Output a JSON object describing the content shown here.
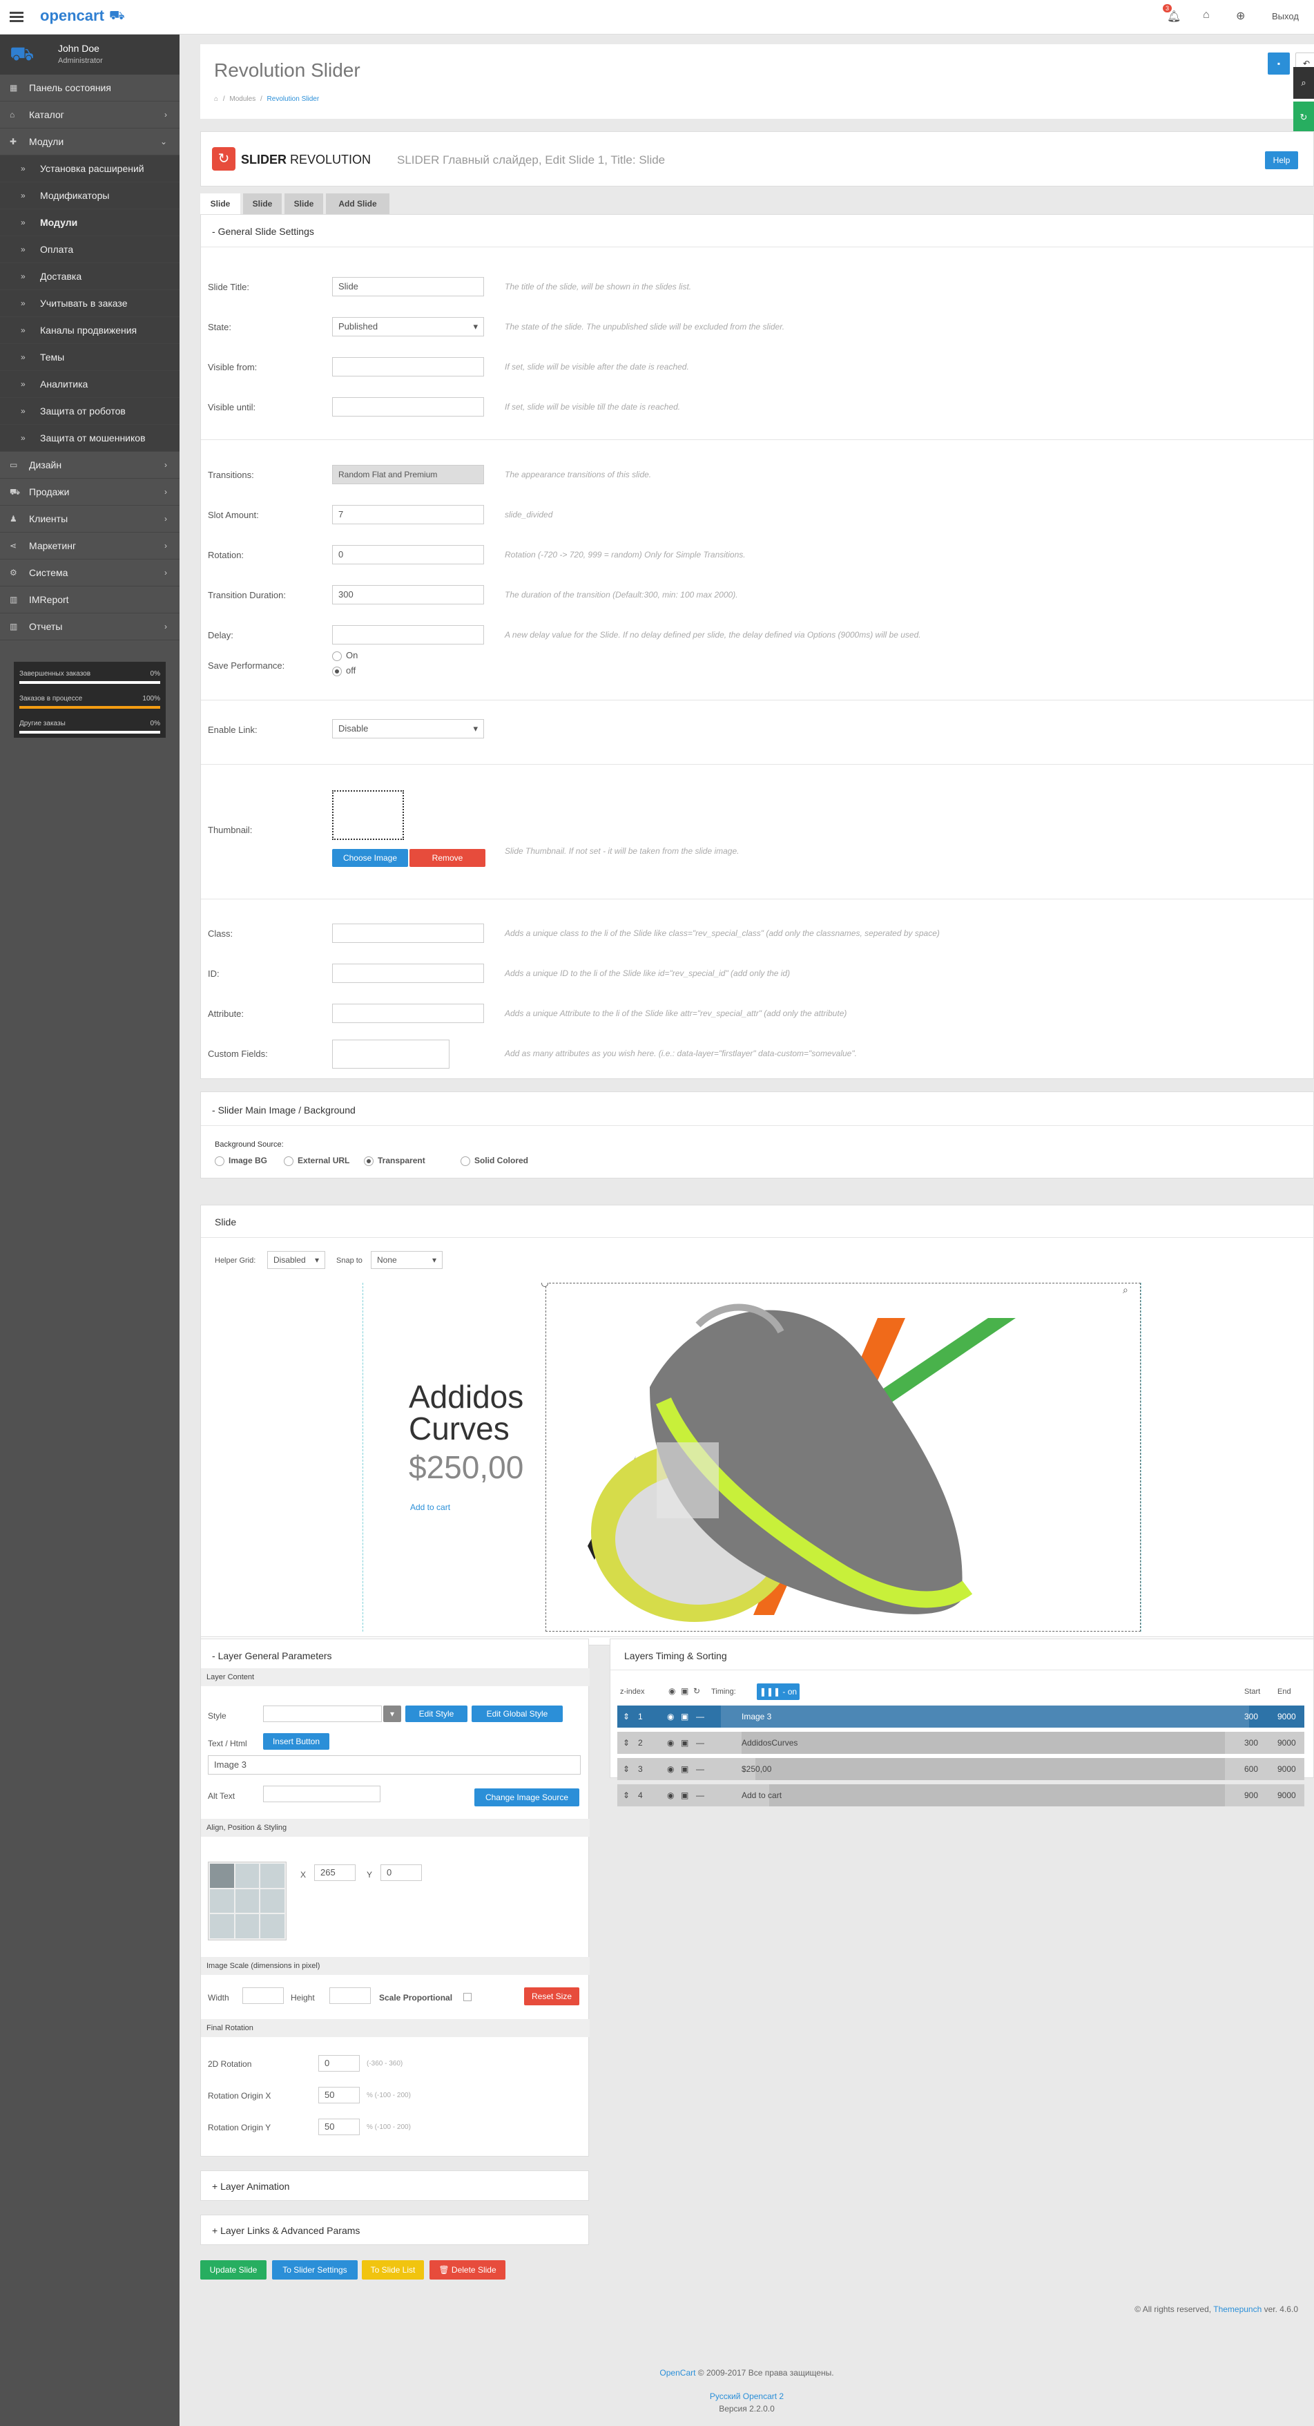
{
  "topbar": {
    "logo_text": "opencart",
    "notif_count": "3",
    "logout_label": "Выход"
  },
  "sidebar": {
    "user_name": "John Doe",
    "user_role": "Administrator",
    "items": [
      {
        "label": "Панель состояния",
        "icon": "dashboard-icon"
      },
      {
        "label": "Каталог",
        "icon": "tag-icon"
      },
      {
        "label": "Модули",
        "icon": "puzzle-icon"
      },
      {
        "label": "Установка расширений"
      },
      {
        "label": "Модификаторы"
      },
      {
        "label": "Модули"
      },
      {
        "label": "Оплата"
      },
      {
        "label": "Доставка"
      },
      {
        "label": "Учитывать в заказе"
      },
      {
        "label": "Каналы продвижения"
      },
      {
        "label": "Темы"
      },
      {
        "label": "Аналитика"
      },
      {
        "label": "Защита от роботов"
      },
      {
        "label": "Защита от мошенников"
      },
      {
        "label": "Дизайн",
        "icon": "monitor-icon"
      },
      {
        "label": "Продажи",
        "icon": "cart-icon"
      },
      {
        "label": "Клиенты",
        "icon": "user-icon"
      },
      {
        "label": "Маркетинг",
        "icon": "share-icon"
      },
      {
        "label": "Система",
        "icon": "cog-icon"
      },
      {
        "label": "IMReport",
        "icon": "chart-icon"
      },
      {
        "label": "Отчеты",
        "icon": "chart-icon"
      }
    ],
    "stats": [
      {
        "label": "Завершенных заказов",
        "value": "0%",
        "fill": 0
      },
      {
        "label": "Заказов в процессе",
        "value": "100%",
        "fill": 1
      },
      {
        "label": "Другие заказы",
        "value": "0%",
        "fill": 0
      }
    ]
  },
  "page": {
    "title": "Revolution Slider",
    "breadcrumb": [
      "Modules",
      "Revolution Slider"
    ]
  },
  "plugin": {
    "logo_bold": "SLIDER",
    "logo_light": "REVOLUTION",
    "subtitle": "SLIDER Главный слайдер, Edit Slide 1, Title: Slide",
    "help_label": "Help",
    "tabs": [
      "Slide",
      "Slide",
      "Slide",
      "Add Slide"
    ]
  },
  "general": {
    "heading": "General Slide Settings",
    "fields": [
      {
        "label": "Slide Title:",
        "value": "Slide",
        "hint": "The title of the slide, will be shown in the slides list."
      },
      {
        "label": "State:",
        "value": "Published",
        "hint": "The state of the slide. The unpublished slide will be excluded from the slider."
      },
      {
        "label": "Visible from:",
        "value": "",
        "hint": "If set, slide will be visible after the date is reached."
      },
      {
        "label": "Visible until:",
        "value": "",
        "hint": "If set, slide will be visible till the date is reached."
      },
      {
        "label": "Transitions:",
        "value": "Random Flat and Premium",
        "hint": "The appearance transitions of this slide."
      },
      {
        "label": "Slot Amount:",
        "value": "7",
        "hint": "slide_divided"
      },
      {
        "label": "Rotation:",
        "value": "0",
        "hint": "Rotation (-720 -> 720, 999 = random) Only for Simple Transitions."
      },
      {
        "label": "Transition Duration:",
        "value": "300",
        "hint": "The duration of the transition (Default:300, min: 100 max 2000)."
      },
      {
        "label": "Delay:",
        "value": "",
        "hint": "A new delay value for the Slide. If no delay defined per slide, the delay defined via Options (9000ms) will be used."
      }
    ],
    "perf_label": "Save Performance:",
    "perf_on": "On",
    "perf_off": "off",
    "link_label": "Enable Link:",
    "link_value": "Disable",
    "thumb_label": "Thumbnail:",
    "thumb_choose": "Choose Image",
    "thumb_remove": "Remove",
    "thumb_hint": "Slide Thumbnail. If not set - it will be taken from the slide image.",
    "extra": [
      {
        "label": "Class:",
        "hint": "Adds a unique class to the li of the Slide like class=\"rev_special_class\" (add only the classnames, seperated by space)"
      },
      {
        "label": "ID:",
        "hint": "Adds a unique ID to the li of the Slide like id=\"rev_special_id\" (add only the id)"
      },
      {
        "label": "Attribute:",
        "hint": "Adds a unique Attribute to the li of the Slide like attr=\"rev_special_attr\" (add only the attribute)"
      },
      {
        "label": "Custom Fields:",
        "hint": "Add as many attributes as you wish here. (i.e.: data-layer=\"firstlayer\" data-custom=\"somevalue\"."
      }
    ]
  },
  "bg": {
    "heading": "Slider Main Image / Background",
    "source_label": "Background Source:",
    "options": [
      "Image BG",
      "External URL",
      "Transparent",
      "Solid Colored"
    ],
    "selected": "Transparent"
  },
  "stage": {
    "heading": "Slide",
    "grid_label": "Helper Grid:",
    "grid_value": "Disabled",
    "snap_label": "Snap to",
    "snap_value": "None",
    "product_title_1": "Addidos",
    "product_title_2": "Curves",
    "price": "$250,00",
    "cart_link": "Add to cart"
  },
  "layer_params": {
    "heading": "Layer General Parameters",
    "content_heading": "Layer Content",
    "style_label": "Style",
    "edit_style": "Edit Style",
    "edit_global": "Edit Global Style",
    "text_label": "Text / Html",
    "insert_button": "Insert Button",
    "text_value": "Image 3",
    "alt_label": "Alt Text",
    "change_image": "Change Image Source",
    "align_heading": "Align, Position & Styling",
    "x_label": "X",
    "x_value": "265",
    "y_label": "Y",
    "y_value": "0",
    "scale_heading": "Image Scale (dimensions in pixel)",
    "width_label": "Width",
    "height_label": "Height",
    "scale_prop": "Scale Proportional",
    "reset_size": "Reset Size",
    "rot_heading": "Final Rotation",
    "rot_fields": [
      {
        "label": "2D Rotation",
        "value": "0",
        "hint": "(-360 - 360)"
      },
      {
        "label": "Rotation Origin X",
        "value": "50",
        "hint": "% (-100 - 200)"
      },
      {
        "label": "Rotation Origin Y",
        "value": "50",
        "hint": "% (-100 - 200)"
      }
    ]
  },
  "timing": {
    "heading": "Layers Timing & Sorting",
    "zindex_label": "z-index",
    "timing_label": "Timing:",
    "timing_toggle": "on",
    "start_label": "Start",
    "end_label": "End",
    "rows": [
      {
        "z": "1",
        "name": "Image 3",
        "start": "300",
        "end": "9000",
        "selected": true
      },
      {
        "z": "2",
        "name": "AddidosCurves",
        "start": "300",
        "end": "9000",
        "selected": false
      },
      {
        "z": "3",
        "name": "$250,00",
        "start": "600",
        "end": "9000",
        "selected": false
      },
      {
        "z": "4",
        "name": "Add to cart",
        "start": "900",
        "end": "9000",
        "selected": false
      }
    ]
  },
  "collapsed": {
    "anim": "Layer Animation",
    "links": "Layer Links & Advanced Params"
  },
  "actions": {
    "update": "Update Slide",
    "settings": "To Slider Settings",
    "list": "To Slide List",
    "delete": "Delete Slide"
  },
  "footer": {
    "copy_pre": "© All rights reserved,",
    "copy_link": "Themepunch",
    "copy_ver": "ver. 4.6.0",
    "oc_link": "OpenCart",
    "oc_text": "© 2009-2017 Все права защищены.",
    "oc_ru": "Русский Opencart 2",
    "oc_version": "Версия 2.2.0.0"
  },
  "colors": {
    "blue": "#2b8fd8",
    "red": "#e74c3c",
    "green": "#27ae60",
    "yellow": "#f1c40f",
    "dark": "#515151"
  }
}
